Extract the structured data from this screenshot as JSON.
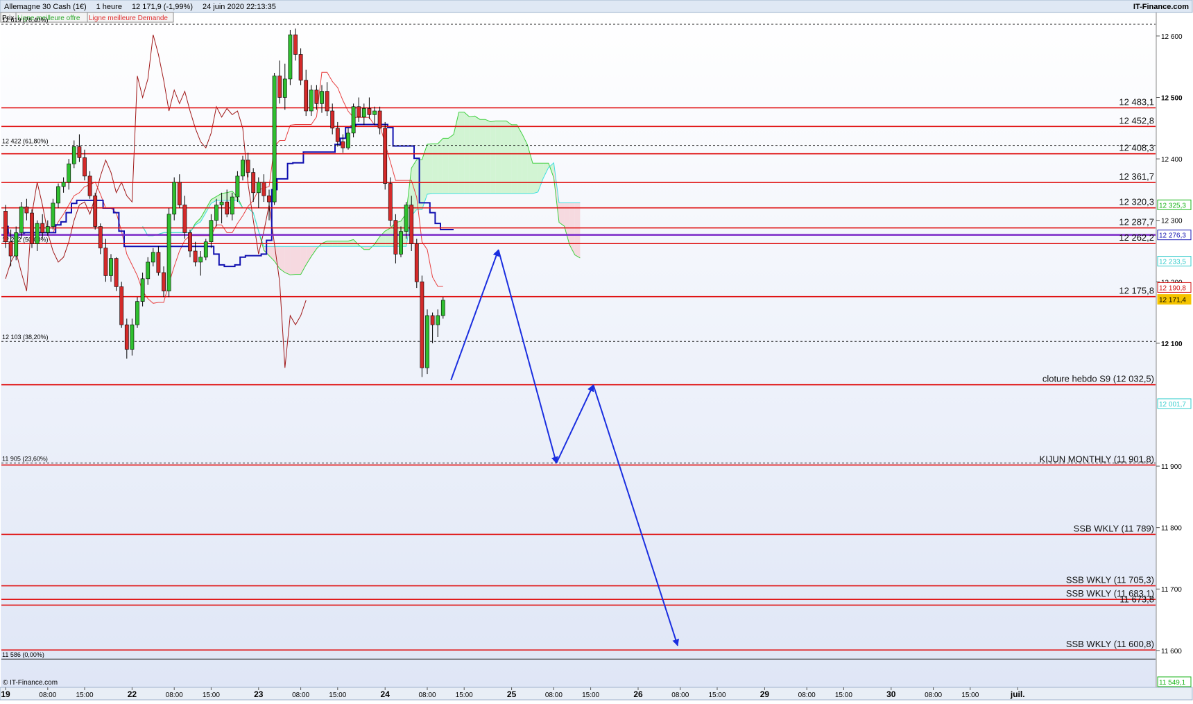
{
  "header": {
    "instrument": "Allemagne 30 Cash (1€)",
    "timeframe": "1 heure",
    "last": "12 171,9 (-1,99%)",
    "datetime": "24 juin 2020 22:13:35",
    "provider": "IT-Finance.com",
    "tab_price": "Prix",
    "legend_offer": "Ligne meilleure offre",
    "legend_demand": "Ligne meilleure Demande"
  },
  "footer": {
    "copyright": "© IT-Finance.com"
  },
  "chart_data": {
    "type": "candlestick",
    "y_axis": {
      "range": [
        11540,
        12636
      ],
      "ticks": [
        {
          "value": 12600,
          "label": "12 600"
        },
        {
          "value": 12500,
          "label": "12 500"
        },
        {
          "value": 12400,
          "label": "12 400"
        },
        {
          "value": 12300,
          "label": "12 300"
        },
        {
          "value": 12200,
          "label": "12 200"
        },
        {
          "value": 12100,
          "label": "12 100"
        },
        {
          "value": 11900,
          "label": "11 900"
        },
        {
          "value": 11800,
          "label": "11 800"
        },
        {
          "value": 11700,
          "label": "11 700"
        },
        {
          "value": 11600,
          "label": "11 600"
        }
      ]
    },
    "x_axis": {
      "labels": [
        {
          "slot": 0,
          "label": "19",
          "major": true
        },
        {
          "slot": 8,
          "label": "08:00",
          "major": false
        },
        {
          "slot": 15,
          "label": "15:00",
          "major": false
        },
        {
          "slot": 24,
          "label": "22",
          "major": true
        },
        {
          "slot": 32,
          "label": "08:00",
          "major": false
        },
        {
          "slot": 39,
          "label": "15:00",
          "major": false
        },
        {
          "slot": 48,
          "label": "23",
          "major": true
        },
        {
          "slot": 56,
          "label": "08:00",
          "major": false
        },
        {
          "slot": 63,
          "label": "15:00",
          "major": false
        },
        {
          "slot": 72,
          "label": "24",
          "major": true
        },
        {
          "slot": 80,
          "label": "08:00",
          "major": false
        },
        {
          "slot": 87,
          "label": "15:00",
          "major": false
        },
        {
          "slot": 96,
          "label": "25",
          "major": true
        },
        {
          "slot": 104,
          "label": "08:00",
          "major": false
        },
        {
          "slot": 111,
          "label": "15:00",
          "major": false
        },
        {
          "slot": 120,
          "label": "26",
          "major": true
        },
        {
          "slot": 128,
          "label": "08:00",
          "major": false
        },
        {
          "slot": 135,
          "label": "15:00",
          "major": false
        },
        {
          "slot": 144,
          "label": "29",
          "major": true
        },
        {
          "slot": 152,
          "label": "08:00",
          "major": false
        },
        {
          "slot": 159,
          "label": "15:00",
          "major": false
        },
        {
          "slot": 168,
          "label": "30",
          "major": true
        },
        {
          "slot": 176,
          "label": "08:00",
          "major": false
        },
        {
          "slot": 183,
          "label": "15:00",
          "major": false
        },
        {
          "slot": 192,
          "label": "juil.",
          "major": true
        }
      ]
    },
    "candles": [
      [
        12315,
        12325,
        12255,
        12265
      ],
      [
        12265,
        12285,
        12225,
        12242
      ],
      [
        12242,
        12290,
        12235,
        12280
      ],
      [
        12280,
        12330,
        12270,
        12322
      ],
      [
        12322,
        12335,
        12300,
        12312
      ],
      [
        12312,
        12318,
        12255,
        12262
      ],
      [
        12262,
        12300,
        12250,
        12295
      ],
      [
        12295,
        12310,
        12270,
        12280
      ],
      [
        12280,
        12300,
        12275,
        12290
      ],
      [
        12290,
        12335,
        12285,
        12328
      ],
      [
        12328,
        12360,
        12320,
        12355
      ],
      [
        12355,
        12370,
        12345,
        12362
      ],
      [
        12362,
        12400,
        12350,
        12392
      ],
      [
        12392,
        12430,
        12385,
        12420
      ],
      [
        12420,
        12440,
        12395,
        12402
      ],
      [
        12402,
        12415,
        12365,
        12372
      ],
      [
        12372,
        12380,
        12335,
        12340
      ],
      [
        12340,
        12345,
        12285,
        12290
      ],
      [
        12290,
        12295,
        12245,
        12255
      ],
      [
        12255,
        12270,
        12200,
        12210
      ],
      [
        12210,
        12245,
        12200,
        12238
      ],
      [
        12238,
        12240,
        12185,
        12192
      ],
      [
        12192,
        12200,
        12125,
        12130
      ],
      [
        12130,
        12140,
        12075,
        12090
      ],
      [
        12090,
        12140,
        12080,
        12130
      ],
      [
        12130,
        12175,
        12125,
        12168
      ],
      [
        12168,
        12215,
        12160,
        12205
      ],
      [
        12205,
        12240,
        12195,
        12232
      ],
      [
        12232,
        12255,
        12225,
        12248
      ],
      [
        12248,
        12258,
        12210,
        12215
      ],
      [
        12215,
        12225,
        12175,
        12185
      ],
      [
        12185,
        12320,
        12175,
        12310
      ],
      [
        12310,
        12370,
        12300,
        12362
      ],
      [
        12362,
        12375,
        12320,
        12325
      ],
      [
        12325,
        12340,
        12270,
        12280
      ],
      [
        12280,
        12285,
        12240,
        12250
      ],
      [
        12250,
        12265,
        12225,
        12232
      ],
      [
        12232,
        12250,
        12210,
        12240
      ],
      [
        12240,
        12270,
        12235,
        12265
      ],
      [
        12265,
        12310,
        12255,
        12300
      ],
      [
        12300,
        12335,
        12290,
        12325
      ],
      [
        12325,
        12345,
        12295,
        12330
      ],
      [
        12330,
        12350,
        12305,
        12310
      ],
      [
        12310,
        12345,
        12300,
        12338
      ],
      [
        12338,
        12380,
        12330,
        12372
      ],
      [
        12372,
        12405,
        12365,
        12398
      ],
      [
        12398,
        12410,
        12370,
        12378
      ],
      [
        12378,
        12385,
        12330,
        12345
      ],
      [
        12345,
        12370,
        12320,
        12362
      ],
      [
        12362,
        12375,
        12330,
        12340
      ],
      [
        12340,
        12350,
        12300,
        12330
      ],
      [
        12330,
        12540,
        12325,
        12535
      ],
      [
        12535,
        12560,
        12490,
        12500
      ],
      [
        12500,
        12555,
        12480,
        12530
      ],
      [
        12530,
        12610,
        12520,
        12602
      ],
      [
        12602,
        12612,
        12560,
        12570
      ],
      [
        12570,
        12580,
        12520,
        12528
      ],
      [
        12528,
        12545,
        12470,
        12478
      ],
      [
        12478,
        12520,
        12470,
        12512
      ],
      [
        12512,
        12520,
        12480,
        12490
      ],
      [
        12490,
        12520,
        12475,
        12510
      ],
      [
        12510,
        12525,
        12470,
        12478
      ],
      [
        12478,
        12490,
        12440,
        12450
      ],
      [
        12450,
        12460,
        12420,
        12428
      ],
      [
        12428,
        12440,
        12410,
        12418
      ],
      [
        12418,
        12450,
        12415,
        12442
      ],
      [
        12442,
        12490,
        12435,
        12485
      ],
      [
        12485,
        12500,
        12460,
        12468
      ],
      [
        12468,
        12490,
        12455,
        12482
      ],
      [
        12482,
        12500,
        12465,
        12472
      ],
      [
        12472,
        12485,
        12455,
        12478
      ],
      [
        12478,
        12485,
        12440,
        12450
      ],
      [
        12450,
        12460,
        12350,
        12360
      ],
      [
        12360,
        12370,
        12290,
        12300
      ],
      [
        12300,
        12310,
        12230,
        12245
      ],
      [
        12245,
        12290,
        12240,
        12282
      ],
      [
        12282,
        12330,
        12270,
        12325
      ],
      [
        12325,
        12340,
        12250,
        12262
      ],
      [
        12262,
        12270,
        12190,
        12200
      ],
      [
        12200,
        12210,
        12045,
        12060
      ],
      [
        12060,
        12155,
        12050,
        12145
      ],
      [
        12145,
        12150,
        12100,
        12130
      ],
      [
        12130,
        12155,
        12110,
        12145
      ],
      [
        12145,
        12175,
        12140,
        12170
      ]
    ],
    "sup_level": 12276.3,
    "labeled_levels": [
      {
        "value": 12483.1,
        "label": "12 483,1"
      },
      {
        "value": 12452.8,
        "label": "12 452,8"
      },
      {
        "value": 12408.3,
        "label": "12 408,3"
      },
      {
        "value": 12361.7,
        "label": "12 361,7"
      },
      {
        "value": 12320.3,
        "label": "12 320,3"
      },
      {
        "value": 12287.7,
        "label": "12 287,7"
      },
      {
        "value": 12262.2,
        "label": "12 262,2"
      },
      {
        "value": 12175.8,
        "label": "12 175,8"
      },
      {
        "value": 12032.5,
        "label": "cloture hebdo S9 (12 032,5)"
      },
      {
        "value": 11901.8,
        "label": "KIJUN MONTHLY (11 901,8)"
      },
      {
        "value": 11789,
        "label": "SSB WKLY (11 789)"
      },
      {
        "value": 11705.3,
        "label": "SSB WKLY (11 705,3)"
      },
      {
        "value": 11683.1,
        "label": "SSB WKLY (11 683,1)"
      },
      {
        "value": 11673.8,
        "label": "11 673,8"
      },
      {
        "value": 11600.8,
        "label": "SSB WKLY (11 600,8)"
      }
    ],
    "fib_levels": [
      {
        "value": 12619,
        "label": "12 619 (76,40%)"
      },
      {
        "value": 12422,
        "label": "12 422 (61,80%)"
      },
      {
        "value": 12262,
        "label": "12 262 (50,00%)"
      },
      {
        "value": 12103,
        "label": "12 103 (38,20%)"
      },
      {
        "value": 11905,
        "label": "11 905 (23,60%)"
      },
      {
        "value": 11586,
        "label": "11 586 (0,00%)"
      }
    ],
    "right_badges": [
      {
        "value": 12325.3,
        "label": "12 325,3",
        "color": "#19b419"
      },
      {
        "value": 12276.3,
        "label": "12 276,3",
        "color": "#1a1ab4"
      },
      {
        "value": 12233.5,
        "label": "12 233,5",
        "color": "#33cccc"
      },
      {
        "value": 12190.8,
        "label": "12 190,8",
        "color": "#d01010"
      },
      {
        "value": 12171.4,
        "label": "12 171,4",
        "color": "#f5c400"
      },
      {
        "value": 12001.7,
        "label": "12 001,7",
        "color": "#33cccc"
      },
      {
        "value": 11549.1,
        "label": "11 549,1",
        "color": "#19b419"
      }
    ],
    "scenario_path": [
      [
        84.5,
        12040
      ],
      [
        93.5,
        12252
      ],
      [
        104.5,
        11905
      ],
      [
        111.5,
        12032
      ],
      [
        127.5,
        11608
      ]
    ],
    "colors": {
      "bull": "#2fbf2f",
      "bear": "#d42a2a",
      "level": "#e01010",
      "kijun": "#1010b0",
      "tenkan": "#e84040",
      "ssa": "#3fcf3f",
      "ssb": "#3fe0e0",
      "chikou": "#a01818",
      "scenario": "#1a2ee0",
      "sup": "#7b2ac8"
    }
  }
}
